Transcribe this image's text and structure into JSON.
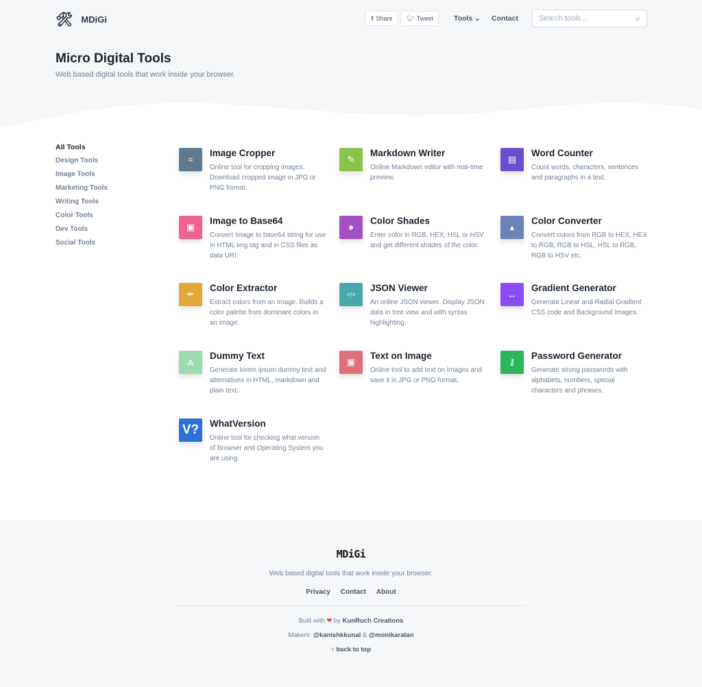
{
  "header": {
    "brand": "MDiGi",
    "share": "Share",
    "tweet": "Tweet",
    "tools": "Tools",
    "contact": "Contact",
    "search_placeholder": "Search tools..."
  },
  "hero": {
    "title": "Micro Digital Tools",
    "subtitle": "Web based digital tools that work inside your browser."
  },
  "sidebar": {
    "items": [
      {
        "label": "All Tools"
      },
      {
        "label": "Design Tools"
      },
      {
        "label": "Image Tools"
      },
      {
        "label": "Marketing Tools"
      },
      {
        "label": "Writing Tools"
      },
      {
        "label": "Color Tools"
      },
      {
        "label": "Dev Tools"
      },
      {
        "label": "Social Tools"
      }
    ]
  },
  "tools": [
    {
      "title": "Image Cropper",
      "desc": "Online tool for cropping images. Download cropped image in JPG or PNG format.",
      "color": "#5f7a8a",
      "icon": "crop-icon",
      "glyph": "⌗"
    },
    {
      "title": "Markdown Writer",
      "desc": "Online Markdown editor with real-time preview.",
      "color": "#8bc34a",
      "icon": "edit-icon",
      "glyph": "✎"
    },
    {
      "title": "Word Counter",
      "desc": "Count words, characters, sentences and paragraphs in a text.",
      "color": "#6a4fcf",
      "icon": "document-icon",
      "glyph": "▤"
    },
    {
      "title": "Image to Base64",
      "desc": "Convert Image to base64 string for use in HTML img tag and in CSS files as data URI.",
      "color": "#f06292",
      "icon": "image-icon",
      "glyph": "▣"
    },
    {
      "title": "Color Shades",
      "desc": "Enter color in RGB, HEX, HSL or HSV and get different shades of the color.",
      "color": "#a450c4",
      "icon": "palette-icon",
      "glyph": "●"
    },
    {
      "title": "Color Converter",
      "desc": "Convert colors from RGB to HEX, HEX to RGB, RGB to HSL, HSL to RGB, RGB to HSV etc.",
      "color": "#6b84b7",
      "icon": "paint-bucket-icon",
      "glyph": "▴"
    },
    {
      "title": "Color Extractor",
      "desc": "Extract colors from an Image. Builds a color palette from dominant colors in an image.",
      "color": "#e2a93a",
      "icon": "eyedropper-icon",
      "glyph": "✒"
    },
    {
      "title": "JSON Viewer",
      "desc": "An online JSON viewer. Display JSON data in tree view and with syntax highlighting.",
      "color": "#4aa8a8",
      "icon": "code-icon",
      "glyph": "</>"
    },
    {
      "title": "Gradient Generator",
      "desc": "Generate Linear and Radial Gradient CSS code and Background Images.",
      "color": "#8a4cf5",
      "icon": "arrows-horizontal-icon",
      "glyph": "↔"
    },
    {
      "title": "Dummy Text",
      "desc": "Generate lorem ipsum dummy text and alternatives in HTML, markdown and plain text.",
      "color": "#9ed9b0",
      "icon": "font-icon",
      "glyph": "A"
    },
    {
      "title": "Text on Image",
      "desc": "Online tool to add text on Images and save it in JPG or PNG format.",
      "color": "#e0707a",
      "icon": "image-icon",
      "glyph": "▣"
    },
    {
      "title": "Password Generator",
      "desc": "Generate strong passwords with alphabets, numbers, special characters and phrases.",
      "color": "#2cb55a",
      "icon": "key-icon",
      "glyph": "⚷"
    },
    {
      "title": "WhatVersion",
      "desc": "Online tool for checking what version of Browser and Operating System you are using.",
      "color": "#2d6fd6",
      "icon": "whatversion-logo-icon",
      "glyph": "V?"
    }
  ],
  "footer": {
    "brand": "MDiGi",
    "tagline": "Web based digital tools that work inside your browser.",
    "links": [
      "Privacy",
      "Contact",
      "About"
    ],
    "built_with": "Built with",
    "by": "by",
    "creator": "KunRuch Creations",
    "makers_label": "Makers:",
    "maker1": "@kanishkkunal",
    "amp": "&",
    "maker2": "@monikaratan",
    "back_to_top": "↑ back to top"
  }
}
